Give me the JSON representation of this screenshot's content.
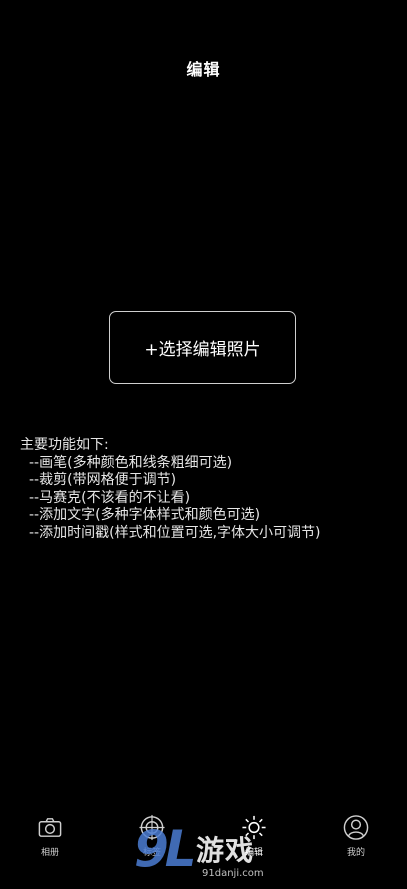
{
  "header": {
    "title": "编辑"
  },
  "main": {
    "select_photo_label": "+选择编辑照片",
    "features_title": "主要功能如下:",
    "features": [
      "--画笔(多种颜色和线条粗细可选)",
      "--裁剪(带网格便于调节)",
      "--马赛克(不该看的不让看)",
      "--添加文字(多种字体样式和颜色可选)",
      "--添加时间戳(样式和位置可选,字体大小可调节)"
    ]
  },
  "tabbar": {
    "items": [
      {
        "label": "相册",
        "icon": "camera-icon"
      },
      {
        "label": "标签",
        "icon": "target-icon"
      },
      {
        "label": "编辑",
        "icon": "sun-icon"
      },
      {
        "label": "我的",
        "icon": "user-icon"
      }
    ],
    "active_index": 2
  },
  "watermark": {
    "number": "9L",
    "name": "游戏",
    "site": "91danji.com"
  },
  "colors": {
    "background": "#000000",
    "text": "#ffffff",
    "border": "#cfcfcf",
    "watermark_blue": "#4b7dd2"
  }
}
